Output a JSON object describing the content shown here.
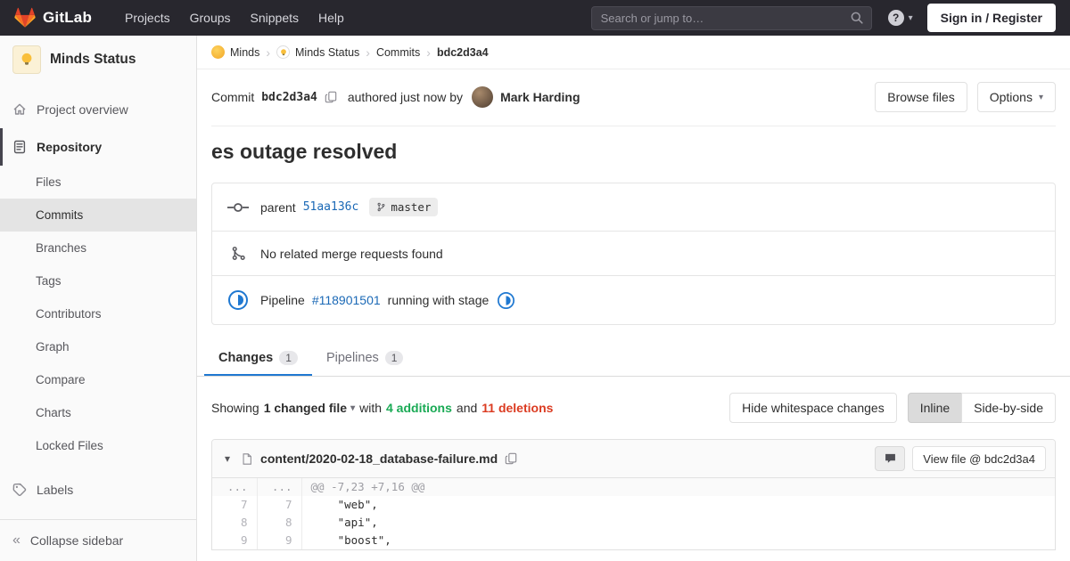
{
  "colors": {
    "navbar_bg": "#28272e",
    "link_blue": "#1b69b6",
    "additions_green": "#1aaa55",
    "deletions_red": "#db3b21",
    "pipeline_running_blue": "#1f78d1"
  },
  "navbar": {
    "brand": "GitLab",
    "menu": [
      "Projects",
      "Groups",
      "Snippets",
      "Help"
    ],
    "search_placeholder": "Search or jump to…",
    "help_glyph": "?",
    "sign_in_label": "Sign in / Register"
  },
  "sidebar": {
    "project_name": "Minds Status",
    "project_overview": "Project overview",
    "repository": "Repository",
    "repo_items": [
      "Files",
      "Commits",
      "Branches",
      "Tags",
      "Contributors",
      "Graph",
      "Compare",
      "Charts",
      "Locked Files"
    ],
    "active_repo_item": "Commits",
    "labels": "Labels",
    "collapse": "Collapse sidebar",
    "collapse_glyph": "«"
  },
  "breadcrumb": {
    "group": "Minds",
    "project": "Minds Status",
    "section": "Commits",
    "sha": "bdc2d3a4",
    "separator": "›"
  },
  "commit": {
    "label": "Commit",
    "sha": "bdc2d3a4",
    "authored": "authored just now by",
    "author": "Mark Harding",
    "browse_files": "Browse files",
    "options": "Options",
    "caret": "▾",
    "title": "es outage resolved"
  },
  "info": {
    "parent_label": "parent",
    "parent_sha": "51aa136c",
    "branch": "master",
    "no_merge_requests": "No related merge requests found",
    "pipeline_label": "Pipeline",
    "pipeline_id": "#118901501",
    "pipeline_status": "running with stage"
  },
  "tabs": {
    "changes": "Changes",
    "changes_count": "1",
    "pipelines": "Pipelines",
    "pipelines_count": "1"
  },
  "summary": {
    "showing": "Showing",
    "changed_file": "1 changed file",
    "caret": "▾",
    "with": "with",
    "additions": "4 additions",
    "and": "and",
    "deletions": "11 deletions",
    "hide_whitespace": "Hide whitespace changes",
    "inline": "Inline",
    "side_by_side": "Side-by-side"
  },
  "diff": {
    "collapse_caret": "▾",
    "file_path": "content/2020-02-18_database-failure.md",
    "view_file": "View file @ bdc2d3a4",
    "hunk_header": "@@ -7,23 +7,16 @@",
    "hunk_dots": "...",
    "lines": [
      {
        "old": "7",
        "new": "7",
        "code": "    \"web\","
      },
      {
        "old": "8",
        "new": "8",
        "code": "    \"api\","
      },
      {
        "old": "9",
        "new": "9",
        "code": "    \"boost\","
      }
    ]
  }
}
